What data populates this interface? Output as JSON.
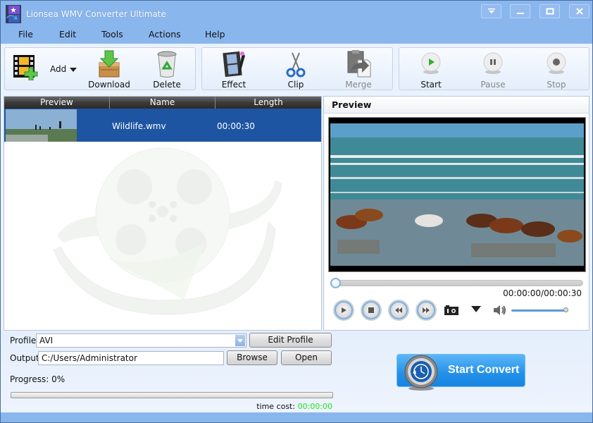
{
  "window": {
    "title": "Lionsea WMV Converter Ultimate",
    "controls": [
      "dropdown-menu",
      "minimize",
      "maximize",
      "close"
    ]
  },
  "menu": {
    "items": [
      {
        "label": "File"
      },
      {
        "label": "Edit"
      },
      {
        "label": "Tools"
      },
      {
        "label": "Actions"
      },
      {
        "label": "Help"
      }
    ]
  },
  "toolbar": {
    "add": {
      "label": "Add",
      "icon": "film-add-icon"
    },
    "download": {
      "label": "Download",
      "icon": "download-box-icon"
    },
    "delete": {
      "label": "Delete",
      "icon": "recycle-bin-icon"
    },
    "effect": {
      "label": "Effect",
      "icon": "film-effect-icon"
    },
    "clip": {
      "label": "Clip",
      "icon": "scissors-icon"
    },
    "merge": {
      "label": "Merge",
      "icon": "merge-doc-icon",
      "disabled": true
    },
    "start": {
      "label": "Start",
      "icon": "play-circle-icon"
    },
    "pause": {
      "label": "Pause",
      "icon": "pause-circle-icon",
      "disabled": true
    },
    "stop": {
      "label": "Stop",
      "icon": "stop-circle-icon",
      "disabled": true
    }
  },
  "filelist": {
    "columns": [
      "Preview",
      "Name",
      "Length"
    ],
    "rows": [
      {
        "name": "Wildlife.wmv",
        "length": "00:00:30",
        "selected": true
      }
    ]
  },
  "preview": {
    "title": "Preview",
    "time": "00:00:00/00:00:30",
    "seek_position": 0,
    "volume": 0.95
  },
  "bottom": {
    "profile_label": "Profile:",
    "profile_value": "AVI",
    "edit_profile": "Edit Profile",
    "output_label": "Output:",
    "output_value": "C:/Users/Administrator",
    "browse": "Browse",
    "open": "Open",
    "progress_label": "Progress: 0%",
    "progress_value": 0,
    "time_cost_label": "time cost:",
    "time_cost_value": "00:00:00",
    "start_convert": "Start Convert"
  },
  "colors": {
    "selection": "#1e55a2",
    "titlebar": "#8ab6ee",
    "time_cost": "#22e022",
    "convert_button": "#2391ea"
  }
}
